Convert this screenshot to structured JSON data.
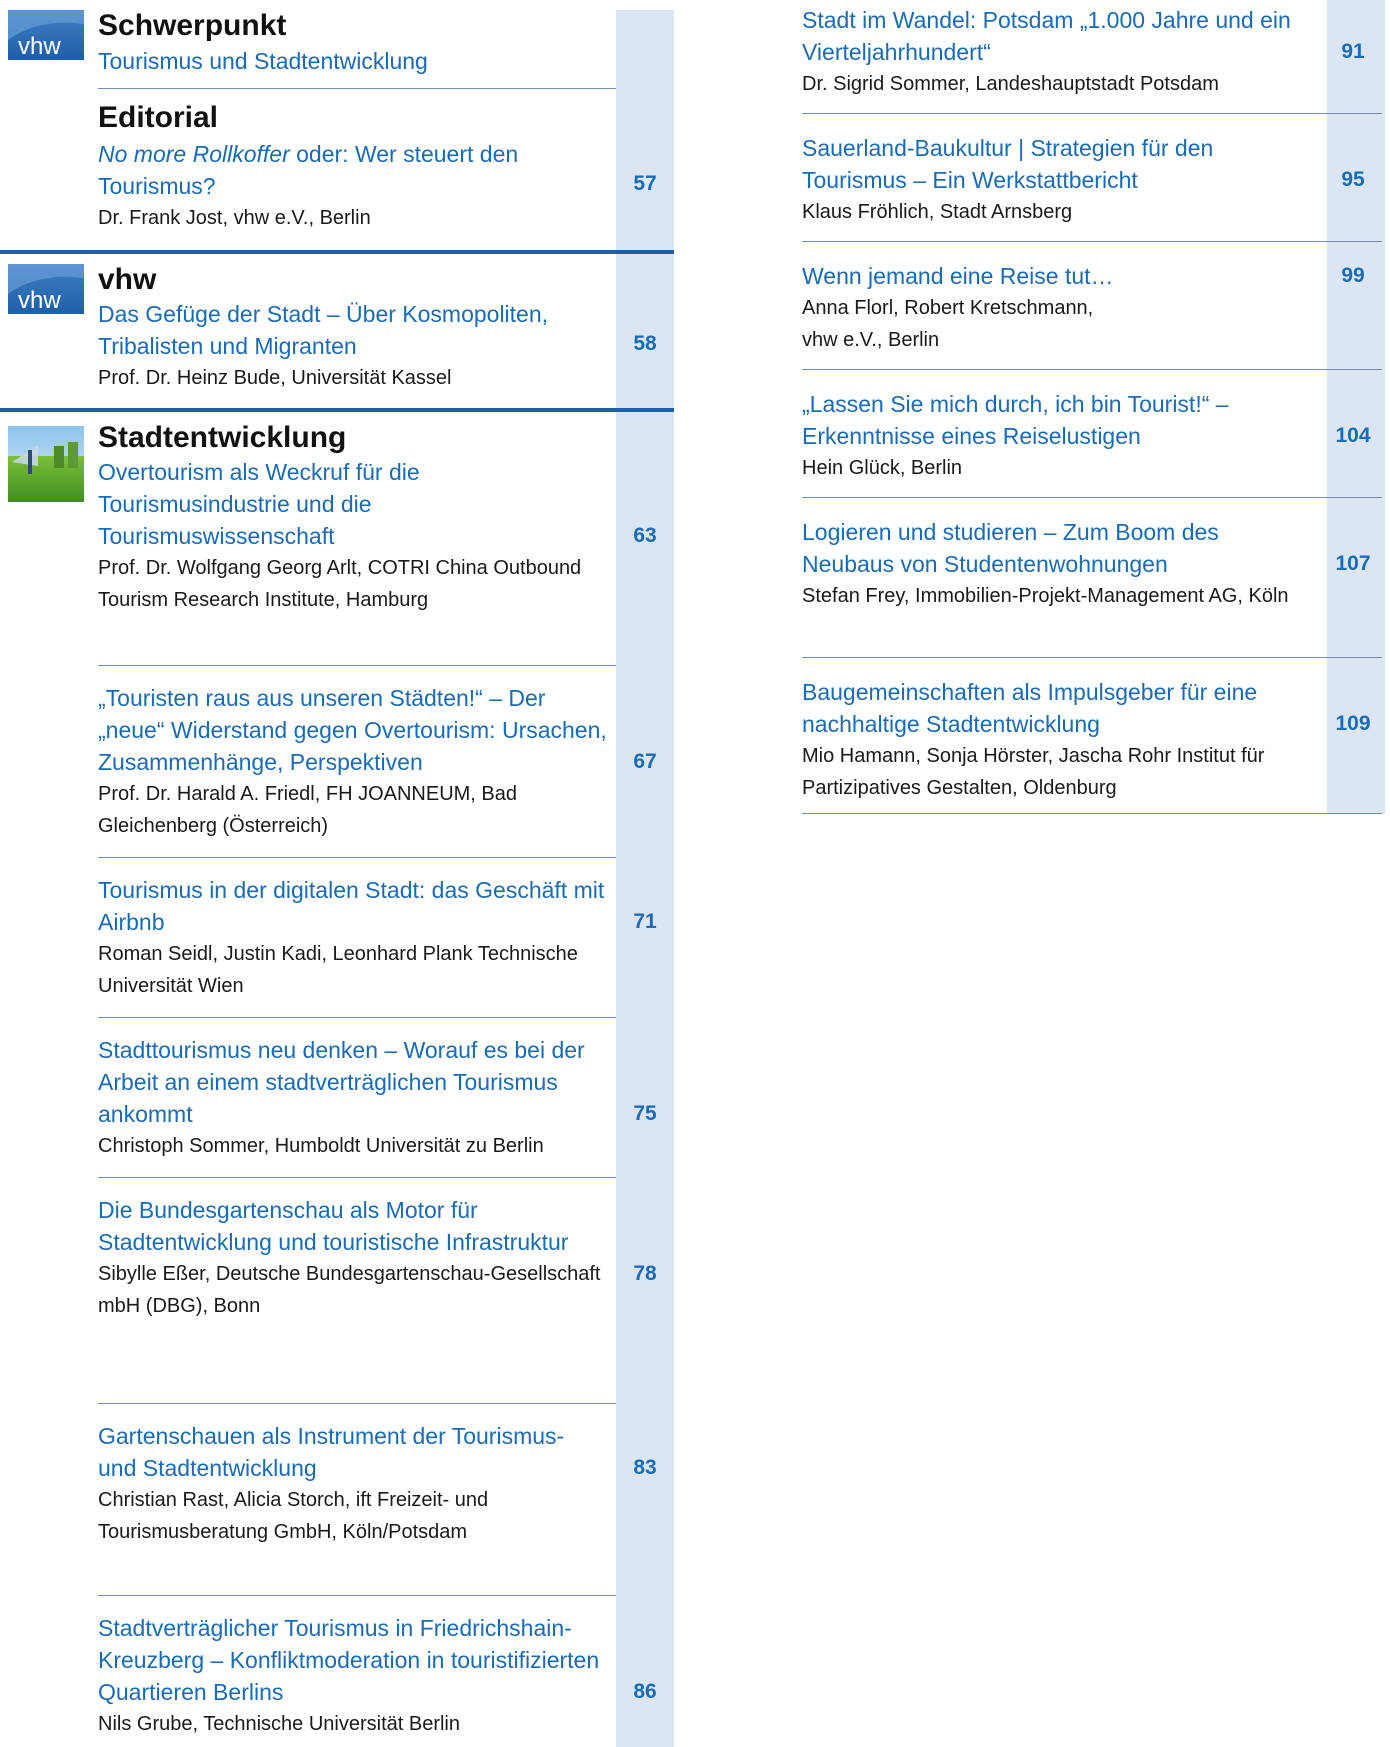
{
  "sections": [
    {
      "heading": "Schwerpunkt",
      "subtitle": "Tourismus und Stadtentwicklung",
      "icon": "vhw-logo-icon"
    },
    {
      "heading": "Editorial",
      "entries": [
        {
          "title_italic": "No more Rollkoffer",
          "title_rest": " oder: Wer steuert den Tourismus?",
          "author": "Dr. Frank Jost, vhw e.V., Berlin",
          "page": "57"
        }
      ]
    },
    {
      "heading": "vhw",
      "icon": "vhw-logo-icon",
      "entries": [
        {
          "title": "Das Gefüge der Stadt – Über Kosmopoliten, Tribalisten und Migranten",
          "author": "Prof. Dr. Heinz Bude, Universität Kassel",
          "page": "58"
        }
      ]
    },
    {
      "heading": "Stadtentwicklung",
      "icon": "city-photo-icon",
      "entries": [
        {
          "title": "Overtourism als Weckruf für die Tourismusindustrie und die Tourismuswissenschaft",
          "author": "Prof. Dr. Wolfgang Georg Arlt, COTRI China Outbound Tourism Research Institute, Hamburg",
          "page": "63"
        },
        {
          "title": "„Touristen raus aus unseren Städten!“ – Der „neue“ Widerstand gegen Overtourism: Ursachen, Zusammenhänge, Perspektiven",
          "author": "Prof. Dr. Harald A. Friedl, FH JOANNEUM, Bad Gleichenberg (Österreich)",
          "page": "67"
        },
        {
          "title": "Tourismus in der digitalen Stadt: das Geschäft mit Airbnb",
          "author": "Roman Seidl, Justin Kadi, Leonhard Plank Technische Universität Wien",
          "page": "71"
        },
        {
          "title": "Stadttourismus neu denken – Worauf es bei der Arbeit an einem stadtverträglichen Tourismus ankommt",
          "author": "Christoph Sommer, Humboldt Universität zu Berlin",
          "page": "75"
        },
        {
          "title": "Die Bundesgartenschau als Motor für Stadtentwicklung und touristische Infrastruktur",
          "author": "Sibylle Eßer, Deutsche Bundesgartenschau-Gesellschaft mbH (DBG), Bonn",
          "page": "78"
        },
        {
          "title": "Gartenschauen als Instrument der Tourismus- und Stadtentwicklung",
          "author": "Christian Rast, Alicia Storch, ift Freizeit- und Tourismusberatung GmbH, Köln/Potsdam",
          "page": "83"
        },
        {
          "title": "Stadtverträglicher Tourismus in Friedrichshain-Kreuzberg – Konfliktmoderation in touristifizierten Quartieren Berlins",
          "author": "Nils Grube, Technische Universität Berlin",
          "page": "86"
        }
      ]
    }
  ],
  "right_entries": [
    {
      "title": "Stadt im Wandel: Potsdam „1.000 Jahre und ein Vierteljahrhundert“",
      "author": "Dr. Sigrid Sommer, Landeshauptstadt Potsdam",
      "page": "91"
    },
    {
      "title": "Sauerland-Baukultur | Strategien für den Tourismus – Ein Werkstattbericht",
      "author": "Klaus Fröhlich, Stadt Arnsberg",
      "page": "95"
    },
    {
      "title": "Wenn jemand eine Reise tut…",
      "author": "Anna Florl, Robert Kretschmann, vhw e.V., Berlin",
      "page": "99"
    },
    {
      "title": "„Lassen Sie mich durch, ich bin Tourist!“ – Erkenntnisse eines Reiselustigen",
      "author": "Hein Glück, Berlin",
      "page": "104"
    },
    {
      "title": "Logieren und studieren – Zum Boom des Neubaus von Studentenwohnungen",
      "author": "Stefan Frey, Immobilien-Projekt-Management AG, Köln",
      "page": "107"
    },
    {
      "title": "Baugemeinschaften als Impulsgeber für eine nachhaltige Stadtentwicklung",
      "author": "Mio Hamann, Sonja Hörster, Jascha Rohr Institut für Partizipatives Gestalten, Oldenburg",
      "page": "109"
    }
  ],
  "colors": {
    "accent": "#1a6bb5",
    "bar": "#dce6f3",
    "rule": "#1f5fa6"
  }
}
